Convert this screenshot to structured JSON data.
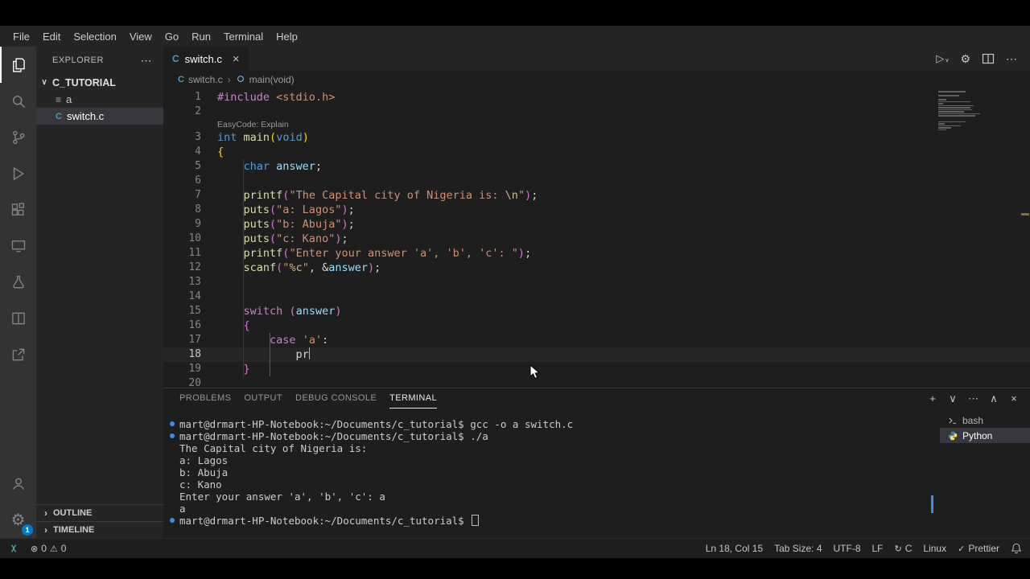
{
  "colors": {
    "accent_blue": "#007acc",
    "editor_bg": "#1e1e1e",
    "sidebar_bg": "#252526",
    "activity_bg": "#333333",
    "selection_bg": "#37373d",
    "c_icon_blue": "#519aba",
    "terminal_decoration_dot": "#3b8eea"
  },
  "icons": {
    "c_file": "C",
    "list_file": "≡",
    "breadcrumb_sep": "›",
    "chevron_down": "∨",
    "chevron_up": "∧",
    "more": "⋯",
    "close": "×",
    "plus": "+",
    "gear": "⚙",
    "play": "▷",
    "error": "⊗",
    "warning": "⚠",
    "check": "✓",
    "sync": "↻"
  },
  "menu_bar": {
    "items": [
      "File",
      "Edit",
      "Selection",
      "View",
      "Go",
      "Run",
      "Terminal",
      "Help"
    ]
  },
  "activity_bar": {
    "items": [
      {
        "id": "explorer",
        "active": true
      },
      {
        "id": "search"
      },
      {
        "id": "source-control"
      },
      {
        "id": "run-debug"
      },
      {
        "id": "extensions"
      },
      {
        "id": "remote-explorer"
      },
      {
        "id": "testing"
      },
      {
        "id": "layout"
      },
      {
        "id": "live-share"
      }
    ],
    "bottom": [
      {
        "id": "account"
      },
      {
        "id": "settings",
        "badge": "1"
      }
    ]
  },
  "sidebar": {
    "title": "EXPLORER",
    "folder": {
      "name": "C_TUTORIAL",
      "expanded": true
    },
    "files": [
      {
        "name": "a",
        "icon": "list",
        "selected": false
      },
      {
        "name": "switch.c",
        "icon": "c",
        "selected": true
      }
    ],
    "sections": [
      {
        "label": "OUTLINE"
      },
      {
        "label": "TIMELINE"
      }
    ]
  },
  "editor": {
    "tabs": [
      {
        "label": "switch.c",
        "active": true
      }
    ],
    "actions": [
      {
        "id": "run-c-file",
        "glyph": "play"
      },
      {
        "id": "settings-gear",
        "glyph": "gear"
      },
      {
        "id": "split-editor",
        "glyph": "split"
      },
      {
        "id": "more-actions",
        "glyph": "more"
      }
    ],
    "breadcrumbs": [
      {
        "label": "switch.c"
      },
      {
        "label": "main(void)"
      }
    ],
    "codelens": {
      "label": "EasyCode: Explain",
      "before_line": 3
    },
    "cursor": {
      "line": 18,
      "col": 15
    },
    "lines": [
      {
        "n": 1,
        "t": [
          [
            "c",
            "#include"
          ],
          [
            "p",
            " "
          ],
          [
            "s",
            "<stdio.h>"
          ]
        ]
      },
      {
        "n": 2,
        "t": []
      },
      {
        "n": 3,
        "t": [
          [
            "k",
            "int"
          ],
          [
            "p",
            " "
          ],
          [
            "f",
            "main"
          ],
          [
            "b1",
            "("
          ],
          [
            "k",
            "void"
          ],
          [
            "b1",
            ")"
          ]
        ]
      },
      {
        "n": 4,
        "t": [
          [
            "b1",
            "{"
          ]
        ]
      },
      {
        "n": 5,
        "t": [
          [
            "p",
            "    "
          ],
          [
            "k",
            "char"
          ],
          [
            "p",
            " "
          ],
          [
            "v",
            "answer"
          ],
          [
            "p",
            ";"
          ]
        ]
      },
      {
        "n": 6,
        "t": []
      },
      {
        "n": 7,
        "t": [
          [
            "p",
            "    "
          ],
          [
            "f",
            "printf"
          ],
          [
            "b2",
            "("
          ],
          [
            "s",
            "\"The Capital city of Nigeria is: "
          ],
          [
            "e",
            "\\n"
          ],
          [
            "s",
            "\""
          ],
          [
            "b2",
            ")"
          ],
          [
            "p",
            ";"
          ]
        ]
      },
      {
        "n": 8,
        "t": [
          [
            "p",
            "    "
          ],
          [
            "f",
            "puts"
          ],
          [
            "b2",
            "("
          ],
          [
            "s",
            "\"a: Lagos\""
          ],
          [
            "b2",
            ")"
          ],
          [
            "p",
            ";"
          ]
        ]
      },
      {
        "n": 9,
        "t": [
          [
            "p",
            "    "
          ],
          [
            "f",
            "puts"
          ],
          [
            "b2",
            "("
          ],
          [
            "s",
            "\"b: Abuja\""
          ],
          [
            "b2",
            ")"
          ],
          [
            "p",
            ";"
          ]
        ]
      },
      {
        "n": 10,
        "t": [
          [
            "p",
            "    "
          ],
          [
            "f",
            "puts"
          ],
          [
            "b2",
            "("
          ],
          [
            "s",
            "\"c: Kano\""
          ],
          [
            "b2",
            ")"
          ],
          [
            "p",
            ";"
          ]
        ]
      },
      {
        "n": 11,
        "t": [
          [
            "p",
            "    "
          ],
          [
            "f",
            "printf"
          ],
          [
            "b2",
            "("
          ],
          [
            "s",
            "\"Enter your answer 'a', 'b', 'c': \""
          ],
          [
            "b2",
            ")"
          ],
          [
            "p",
            ";"
          ]
        ]
      },
      {
        "n": 12,
        "t": [
          [
            "p",
            "    "
          ],
          [
            "f",
            "scanf"
          ],
          [
            "b2",
            "("
          ],
          [
            "s",
            "\""
          ],
          [
            "e",
            "%c"
          ],
          [
            "s",
            "\""
          ],
          [
            "p",
            ", &"
          ],
          [
            "v",
            "answer"
          ],
          [
            "b2",
            ")"
          ],
          [
            "p",
            ";"
          ]
        ]
      },
      {
        "n": 13,
        "t": []
      },
      {
        "n": 14,
        "t": []
      },
      {
        "n": 15,
        "t": [
          [
            "p",
            "    "
          ],
          [
            "c",
            "switch"
          ],
          [
            "p",
            " "
          ],
          [
            "b2",
            "("
          ],
          [
            "v",
            "answer"
          ],
          [
            "b2",
            ")"
          ]
        ]
      },
      {
        "n": 16,
        "t": [
          [
            "p",
            "    "
          ],
          [
            "b2",
            "{"
          ]
        ]
      },
      {
        "n": 17,
        "t": [
          [
            "p",
            "        "
          ],
          [
            "c",
            "case"
          ],
          [
            "p",
            " "
          ],
          [
            "s",
            "'a'"
          ],
          [
            "p",
            ":"
          ]
        ]
      },
      {
        "n": 18,
        "t": [
          [
            "p",
            "            pr"
          ]
        ],
        "cursor": true,
        "current": true
      },
      {
        "n": 19,
        "t": [
          [
            "p",
            "    "
          ],
          [
            "b2",
            "}"
          ]
        ]
      },
      {
        "n": 20,
        "t": []
      }
    ]
  },
  "panel": {
    "tabs": [
      {
        "label": "PROBLEMS"
      },
      {
        "label": "OUTPUT"
      },
      {
        "label": "DEBUG CONSOLE"
      },
      {
        "label": "TERMINAL",
        "active": true
      }
    ],
    "actions": [
      {
        "id": "new-terminal",
        "glyph": "plus"
      },
      {
        "id": "terminal-picker",
        "glyph": "chevron_down"
      },
      {
        "id": "more-actions",
        "glyph": "more"
      },
      {
        "id": "maximize-panel",
        "glyph": "chevron_up"
      },
      {
        "id": "close-panel",
        "glyph": "close"
      }
    ]
  },
  "terminal": {
    "lines": [
      {
        "dot": true,
        "text": "mart@drmart-HP-Notebook:~/Documents/c_tutorial$ gcc -o a switch.c"
      },
      {
        "dot": true,
        "text": "mart@drmart-HP-Notebook:~/Documents/c_tutorial$ ./a"
      },
      {
        "text": "The Capital city of Nigeria is: "
      },
      {
        "text": "a: Lagos"
      },
      {
        "text": "b: Abuja"
      },
      {
        "text": "c: Kano"
      },
      {
        "text": "Enter your answer 'a', 'b', 'c': a"
      },
      {
        "text": "a"
      },
      {
        "dot": true,
        "text": "mart@drmart-HP-Notebook:~/Documents/c_tutorial$ ",
        "cursor": true
      }
    ],
    "sessions": [
      {
        "label": "bash",
        "icon": "terminal"
      },
      {
        "label": "Python",
        "icon": "python",
        "selected": true
      }
    ]
  },
  "status_bar": {
    "problems": {
      "errors": "0",
      "warnings": "0"
    },
    "right": [
      {
        "id": "cursor-position",
        "label": "Ln 18, Col 15"
      },
      {
        "id": "indentation",
        "label": "Tab Size: 4"
      },
      {
        "id": "encoding",
        "label": "UTF-8"
      },
      {
        "id": "eol",
        "label": "LF"
      },
      {
        "id": "language-status",
        "icon": "sync",
        "label": "C"
      },
      {
        "id": "os-indicator",
        "label": "Linux"
      },
      {
        "id": "formatter",
        "icon": "check",
        "label": "Prettier"
      },
      {
        "id": "notifications",
        "icon": "bell"
      }
    ]
  }
}
